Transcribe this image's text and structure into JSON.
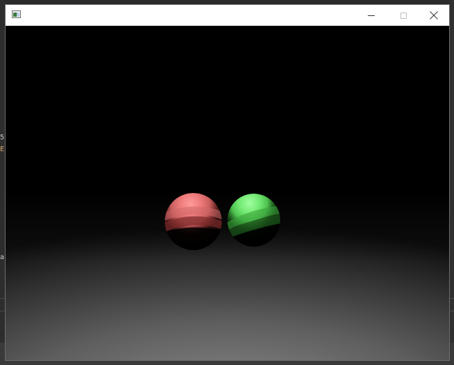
{
  "window": {
    "title": "",
    "icon": "app-window-icon",
    "controls": {
      "minimize": "minimize-icon",
      "maximize": "maximize-icon",
      "close": "close-icon"
    }
  },
  "scene": {
    "background_color": "#000000",
    "floor_color_far": "#1a1a1a",
    "floor_color_near": "#7a7a7a",
    "spheres": [
      {
        "name": "red-sphere",
        "color": "#ff8080"
      },
      {
        "name": "green-sphere",
        "color": "#80ff80"
      }
    ]
  },
  "background_fragments": {
    "left_1": "5",
    "left_2": "E",
    "left_3": "ar"
  }
}
